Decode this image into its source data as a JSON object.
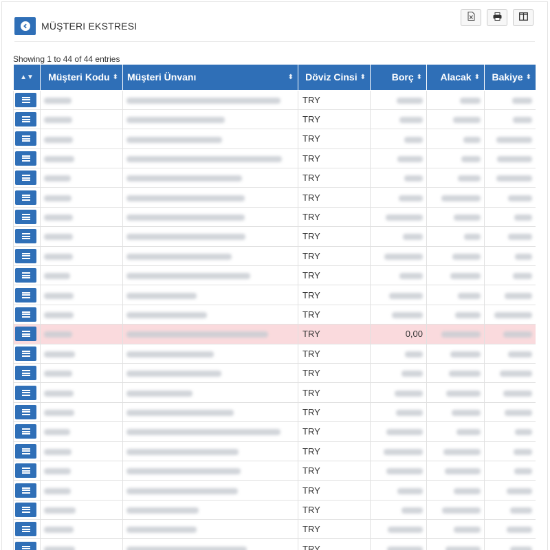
{
  "page": {
    "title": "MÜŞTERI EKSTRESI",
    "back_icon": "chevron-left-icon",
    "toolbar": [
      {
        "name": "export-excel-button",
        "icon": "file-excel-icon"
      },
      {
        "name": "print-button",
        "icon": "print-icon"
      },
      {
        "name": "columns-button",
        "icon": "columns-icon"
      }
    ],
    "info": "Showing 1 to 44 of 44 entries"
  },
  "table": {
    "columns": [
      {
        "key": "action",
        "label": ""
      },
      {
        "key": "code",
        "label": "Müşteri Kodu"
      },
      {
        "key": "title",
        "label": "Müşteri Ünvanı"
      },
      {
        "key": "currency",
        "label": "Döviz Cinsi"
      },
      {
        "key": "debit",
        "label": "Borç"
      },
      {
        "key": "credit",
        "label": "Alacak"
      },
      {
        "key": "balance",
        "label": "Bakiye"
      }
    ],
    "colors": {
      "header_bg": "#2f6fb7",
      "highlight_row": "#fadadd"
    },
    "rows": [
      {
        "currency": "TRY",
        "debit": "",
        "credit": "",
        "balance": "",
        "highlight": false
      },
      {
        "currency": "TRY",
        "debit": "",
        "credit": "",
        "balance": "",
        "highlight": false
      },
      {
        "currency": "TRY",
        "debit": "",
        "credit": "",
        "balance": "",
        "highlight": false
      },
      {
        "currency": "TRY",
        "debit": "",
        "credit": "",
        "balance": "",
        "highlight": false
      },
      {
        "currency": "TRY",
        "debit": "",
        "credit": "",
        "balance": "",
        "highlight": false
      },
      {
        "currency": "TRY",
        "debit": "",
        "credit": "",
        "balance": "",
        "highlight": false
      },
      {
        "currency": "TRY",
        "debit": "",
        "credit": "",
        "balance": "",
        "highlight": false
      },
      {
        "currency": "TRY",
        "debit": "",
        "credit": "",
        "balance": "",
        "highlight": false
      },
      {
        "currency": "TRY",
        "debit": "",
        "credit": "",
        "balance": "",
        "highlight": false
      },
      {
        "currency": "TRY",
        "debit": "",
        "credit": "",
        "balance": "",
        "highlight": false
      },
      {
        "currency": "TRY",
        "debit": "",
        "credit": "",
        "balance": "",
        "highlight": false
      },
      {
        "currency": "TRY",
        "debit": "",
        "credit": "",
        "balance": "",
        "highlight": false
      },
      {
        "currency": "TRY",
        "debit": "0,00",
        "credit": "",
        "balance": "",
        "highlight": true
      },
      {
        "currency": "TRY",
        "debit": "",
        "credit": "",
        "balance": "",
        "highlight": false
      },
      {
        "currency": "TRY",
        "debit": "",
        "credit": "",
        "balance": "",
        "highlight": false
      },
      {
        "currency": "TRY",
        "debit": "",
        "credit": "",
        "balance": "",
        "highlight": false
      },
      {
        "currency": "TRY",
        "debit": "",
        "credit": "",
        "balance": "",
        "highlight": false
      },
      {
        "currency": "TRY",
        "debit": "",
        "credit": "",
        "balance": "",
        "highlight": false
      },
      {
        "currency": "TRY",
        "debit": "",
        "credit": "",
        "balance": "",
        "highlight": false
      },
      {
        "currency": "TRY",
        "debit": "",
        "credit": "",
        "balance": "",
        "highlight": false
      },
      {
        "currency": "TRY",
        "debit": "",
        "credit": "",
        "balance": "",
        "highlight": false
      },
      {
        "currency": "TRY",
        "debit": "",
        "credit": "",
        "balance": "",
        "highlight": false
      },
      {
        "currency": "TRY",
        "debit": "",
        "credit": "",
        "balance": "",
        "highlight": false
      },
      {
        "currency": "TRY",
        "debit": "",
        "credit": "",
        "balance": "",
        "highlight": false
      }
    ]
  }
}
